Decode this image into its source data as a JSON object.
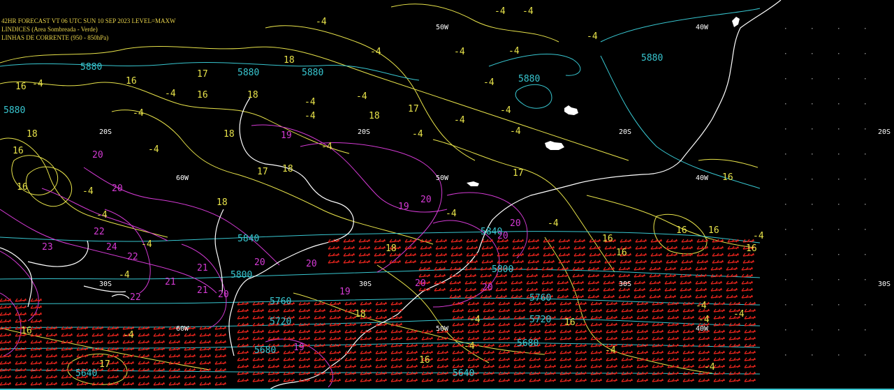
{
  "header": {
    "line1": "42HR FORECAST   VT 06 UTC SUN 10 SEP 2023   LEVEL=MAXW",
    "line2": "LINDICES (Area Sombreada - Verde)",
    "line3": "LINHAS DE CORRENTE (950 - 850hPa)"
  },
  "colors": {
    "background": "#000000",
    "coastline": "#ffffff",
    "height_contours": "#38c7d1",
    "index_contours": "#e8e34a",
    "streamlines": "#d43ad4",
    "wind_barbs": "#e8241c",
    "grid_labels": "#ffffff"
  },
  "grid_labels": {
    "lat_20s": "20S",
    "lat_30s": "30S",
    "lon_40w": "40W",
    "lon_50w": "50W",
    "lon_60w": "60W"
  },
  "height_labels": [
    "5880",
    "5840",
    "5800",
    "5760",
    "5720",
    "5680",
    "5640"
  ],
  "index_labels": [
    "-4",
    "16",
    "17",
    "18"
  ],
  "streamline_labels": [
    "19",
    "20",
    "21",
    "22",
    "23",
    "24"
  ]
}
